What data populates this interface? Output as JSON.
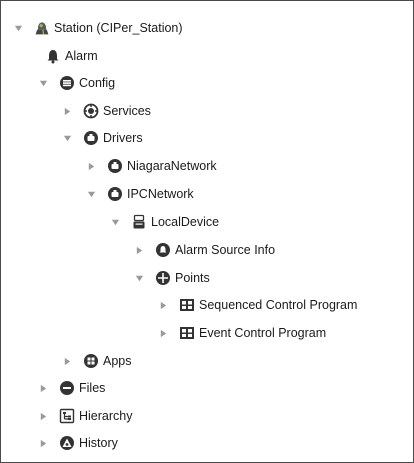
{
  "tree": {
    "nodes": [
      {
        "label": "Station (CIPer_Station)",
        "icon": "station-icon",
        "state": "expanded"
      },
      {
        "label": "Alarm",
        "icon": "bell-icon",
        "state": "leaf"
      },
      {
        "label": "Config",
        "icon": "config-icon",
        "state": "expanded"
      },
      {
        "label": "Services",
        "icon": "services-icon",
        "state": "collapsed"
      },
      {
        "label": "Drivers",
        "icon": "drivers-icon",
        "state": "expanded"
      },
      {
        "label": "NiagaraNetwork",
        "icon": "network-icon",
        "state": "collapsed"
      },
      {
        "label": "IPCNetwork",
        "icon": "network-icon",
        "state": "expanded"
      },
      {
        "label": "LocalDevice",
        "icon": "device-icon",
        "state": "expanded"
      },
      {
        "label": "Alarm Source Info",
        "icon": "alarm-source-icon",
        "state": "collapsed"
      },
      {
        "label": "Points",
        "icon": "points-icon",
        "state": "expanded"
      },
      {
        "label": "Sequenced Control Program",
        "icon": "program-icon",
        "state": "collapsed"
      },
      {
        "label": "Event Control Program",
        "icon": "program-icon",
        "state": "collapsed"
      },
      {
        "label": "Apps",
        "icon": "apps-icon",
        "state": "collapsed"
      },
      {
        "label": "Files",
        "icon": "files-icon",
        "state": "collapsed"
      },
      {
        "label": "Hierarchy",
        "icon": "hierarchy-icon",
        "state": "collapsed"
      },
      {
        "label": "History",
        "icon": "history-icon",
        "state": "collapsed"
      }
    ]
  },
  "colors": {
    "text": "#1b1b1b",
    "toggle": "#9a9a9a",
    "icon": "#333333",
    "station_accent": "#8bc34a",
    "border": "#4a4a4a"
  }
}
